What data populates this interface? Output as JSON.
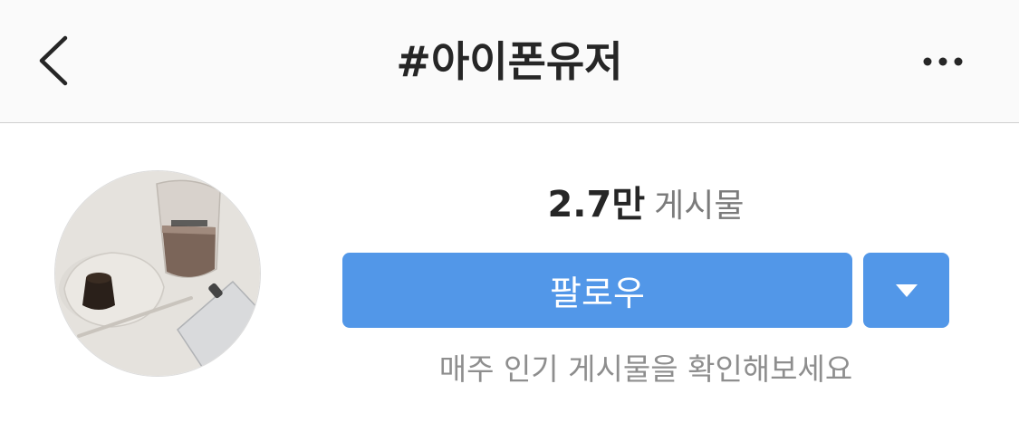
{
  "header": {
    "title": "#아이폰유저",
    "back_icon": "chevron-left-icon",
    "more_icon": "more-horizontal-icon"
  },
  "profile": {
    "avatar_alt": "hashtag top post image"
  },
  "stats": {
    "posts_count": "2.7만",
    "posts_label": "게시물"
  },
  "actions": {
    "follow_label": "팔로우",
    "dropdown_icon": "caret-down-icon"
  },
  "subtext": "매주 인기 게시물을 확인해보세요",
  "colors": {
    "accent": "#5297e8",
    "header_bg": "#fafafa",
    "text_primary": "#262626",
    "text_secondary": "#8e8e8e"
  }
}
